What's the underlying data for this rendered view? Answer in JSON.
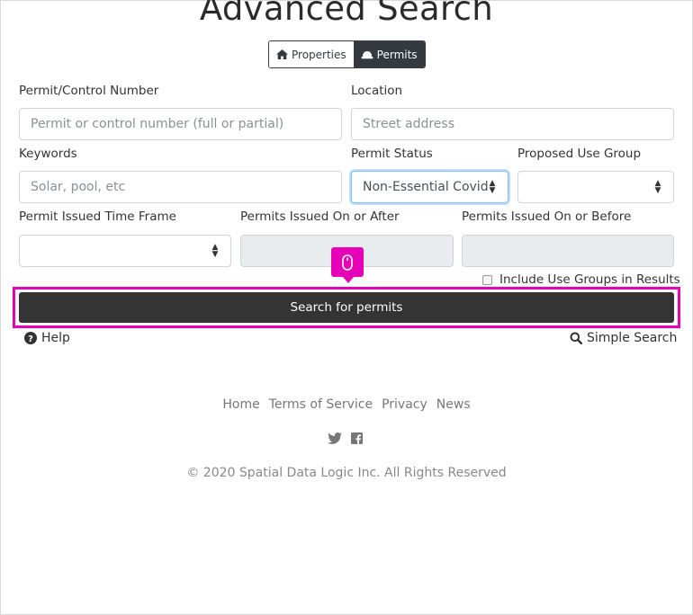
{
  "page": {
    "title": "Advanced Search"
  },
  "toggle": {
    "properties_label": "Properties",
    "permits_label": "Permits"
  },
  "form": {
    "permit_number": {
      "label": "Permit/Control Number",
      "placeholder": "Permit or control number (full or partial)"
    },
    "location": {
      "label": "Location",
      "placeholder": "Street address"
    },
    "keywords": {
      "label": "Keywords",
      "placeholder": "Solar, pool, etc"
    },
    "permit_status": {
      "label": "Permit Status",
      "value": "Non-Essential Covid"
    },
    "proposed_use_group": {
      "label": "Proposed Use Group",
      "value": ""
    },
    "issued_time_frame": {
      "label": "Permit Issued Time Frame",
      "value": ""
    },
    "issued_on_or_after": {
      "label": "Permits Issued On or After",
      "value": ""
    },
    "issued_on_or_before": {
      "label": "Permits Issued On or Before",
      "value": ""
    },
    "include_use_groups": {
      "label": "Include Use Groups in Results",
      "checked": false
    }
  },
  "actions": {
    "search_label": "Search for permits",
    "help_label": "Help",
    "simple_search_label": "Simple Search"
  },
  "footer": {
    "links": [
      "Home",
      "Terms of Service",
      "Privacy",
      "News"
    ],
    "social_icons": [
      "twitter-icon",
      "facebook-icon"
    ],
    "copyright": "© 2020 Spatial Data Logic Inc. All Rights Reserved"
  },
  "colors": {
    "highlight": "#e600b8",
    "button_dark": "#343434",
    "toggle_dark": "#343a40"
  }
}
